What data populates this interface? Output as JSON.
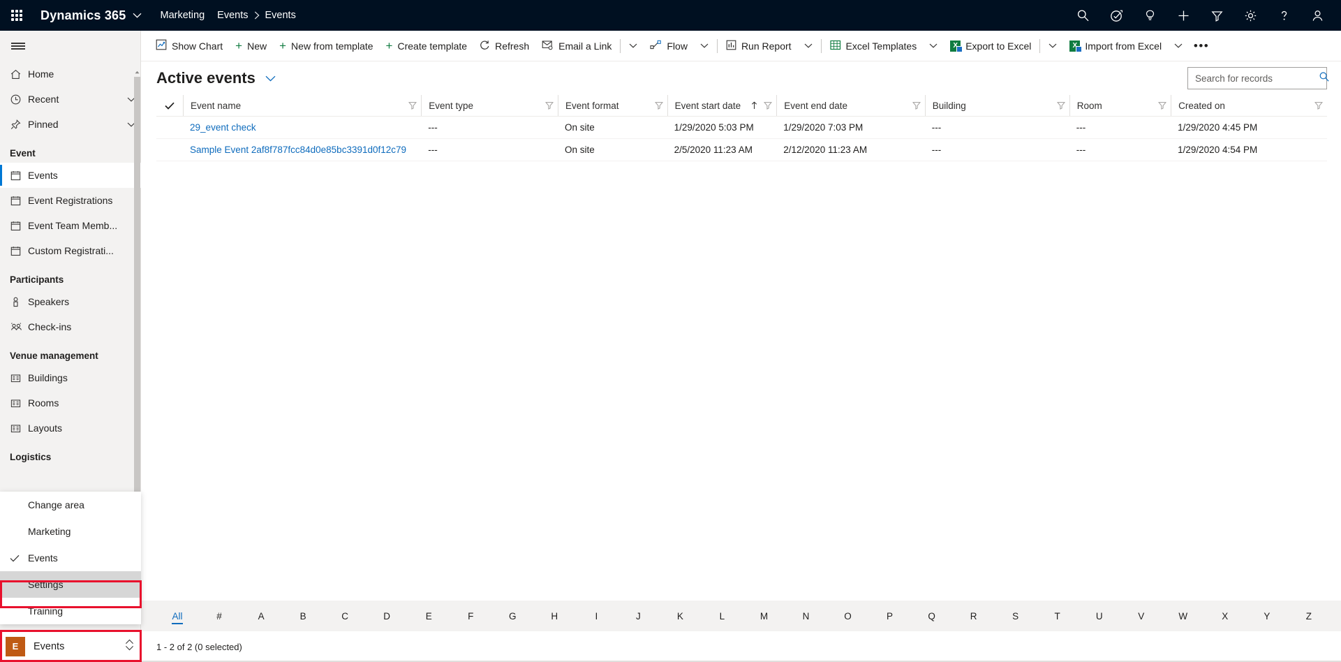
{
  "topbar": {
    "waffle_label": "app-launcher",
    "brand": "Dynamics 365",
    "app_name": "Marketing",
    "breadcrumb": [
      "Events",
      "Events"
    ],
    "icons": [
      {
        "name": "search-icon",
        "label": "Search"
      },
      {
        "name": "diagnostics-icon",
        "label": "Diagnostics"
      },
      {
        "name": "lightbulb-icon",
        "label": "Ideas"
      },
      {
        "name": "add-icon",
        "label": "Quick create"
      },
      {
        "name": "filter-icon",
        "label": "Advanced filter"
      },
      {
        "name": "gear-icon",
        "label": "Settings"
      },
      {
        "name": "help-icon",
        "label": "Help"
      },
      {
        "name": "user-avatar-icon",
        "label": "Account manager"
      }
    ]
  },
  "sidebar": {
    "hamburger_label": "Expand navigation",
    "items": [
      {
        "label": "Home",
        "icon": "home-icon",
        "chevron": false,
        "selected": false,
        "group": null
      },
      {
        "label": "Recent",
        "icon": "clock-icon",
        "chevron": true,
        "selected": false,
        "group": null
      },
      {
        "label": "Pinned",
        "icon": "pin-icon",
        "chevron": true,
        "selected": false,
        "group": null
      }
    ],
    "groups": [
      {
        "title": "Event",
        "items": [
          {
            "label": "Events",
            "icon": "calendar-icon",
            "selected": true
          },
          {
            "label": "Event Registrations",
            "icon": "calendar-icon",
            "selected": false
          },
          {
            "label": "Event Team Memb...",
            "icon": "calendar-icon",
            "selected": false
          },
          {
            "label": "Custom Registrati...",
            "icon": "calendar-icon",
            "selected": false
          }
        ]
      },
      {
        "title": "Participants",
        "items": [
          {
            "label": "Speakers",
            "icon": "speaker-person-icon",
            "selected": false
          },
          {
            "label": "Check-ins",
            "icon": "people-icon",
            "selected": false
          }
        ]
      },
      {
        "title": "Venue management",
        "items": [
          {
            "label": "Buildings",
            "icon": "building-icon",
            "selected": false
          },
          {
            "label": "Rooms",
            "icon": "building-icon",
            "selected": false
          },
          {
            "label": "Layouts",
            "icon": "building-icon",
            "selected": false
          }
        ]
      },
      {
        "title": "Logistics",
        "items": []
      }
    ],
    "area_flyout": {
      "items": [
        {
          "label": "Change area",
          "checked": false,
          "hovered": false
        },
        {
          "label": "Marketing",
          "checked": false,
          "hovered": false
        },
        {
          "label": "Events",
          "checked": true,
          "hovered": false
        },
        {
          "label": "Settings",
          "checked": false,
          "hovered": true
        },
        {
          "label": "Training",
          "checked": false,
          "hovered": false
        }
      ]
    },
    "area_switcher": {
      "badge": "E",
      "label": "Events",
      "badge_color": "#bf5a14"
    }
  },
  "commandbar": {
    "items": [
      {
        "label": "Show Chart",
        "icon": "chart-icon",
        "caret": false
      },
      {
        "label": "New",
        "icon": "plus-icon",
        "caret": false
      },
      {
        "label": "New from template",
        "icon": "plus-icon",
        "caret": false
      },
      {
        "label": "Create template",
        "icon": "plus-icon",
        "caret": false
      },
      {
        "label": "Refresh",
        "icon": "refresh-icon",
        "caret": false
      },
      {
        "label": "Email a Link",
        "icon": "email-link-icon",
        "caret": true,
        "divider_before_caret": true
      },
      {
        "label": "Flow",
        "icon": "flow-icon",
        "caret": true
      },
      {
        "label": "Run Report",
        "icon": "report-icon",
        "caret": true
      },
      {
        "label": "Excel Templates",
        "icon": "excel-icon",
        "caret": true
      },
      {
        "label": "Export to Excel",
        "icon": "excel-icon",
        "caret": true,
        "divider_before_caret": true
      },
      {
        "label": "Import from Excel",
        "icon": "excel-icon",
        "caret": true
      }
    ],
    "overflow_label": "•••"
  },
  "main": {
    "view_title": "Active events",
    "view_caret_name": "view-selector-chevron-icon",
    "search": {
      "placeholder": "Search for records",
      "value": "",
      "icon": "search-icon"
    },
    "grid": {
      "columns": [
        {
          "label": "Event name",
          "filter": true,
          "sort": null
        },
        {
          "label": "Event type",
          "filter": true,
          "sort": null
        },
        {
          "label": "Event format",
          "filter": true,
          "sort": null
        },
        {
          "label": "Event start date",
          "filter": true,
          "sort": "asc"
        },
        {
          "label": "Event end date",
          "filter": true,
          "sort": null
        },
        {
          "label": "Building",
          "filter": true,
          "sort": null
        },
        {
          "label": "Room",
          "filter": true,
          "sort": null
        },
        {
          "label": "Created on",
          "filter": true,
          "sort": null
        }
      ],
      "rows": [
        {
          "event_name": "29_event check",
          "event_type": "---",
          "event_format": "On site",
          "event_start_date": "1/29/2020 5:03 PM",
          "event_end_date": "1/29/2020 7:03 PM",
          "building": "---",
          "room": "---",
          "created_on": "1/29/2020 4:45 PM"
        },
        {
          "event_name": "Sample Event 2af8f787fcc84d0e85bc3391d0f12c79",
          "event_type": "---",
          "event_format": "On site",
          "event_start_date": "2/5/2020 11:23 AM",
          "event_end_date": "2/12/2020 11:23 AM",
          "building": "---",
          "room": "---",
          "created_on": "1/29/2020 4:54 PM"
        }
      ]
    },
    "alpha_filter": {
      "active": "All",
      "items": [
        "All",
        "#",
        "A",
        "B",
        "C",
        "D",
        "E",
        "F",
        "G",
        "H",
        "I",
        "J",
        "K",
        "L",
        "M",
        "N",
        "O",
        "P",
        "Q",
        "R",
        "S",
        "T",
        "U",
        "V",
        "W",
        "X",
        "Y",
        "Z"
      ]
    },
    "status": "1 - 2 of 2 (0 selected)"
  },
  "colors": {
    "nav_dark": "#001021",
    "accent_blue": "#0078d4",
    "link_blue": "#0f6cbd",
    "excel_green": "#107c41",
    "highlight_red": "#e8112d",
    "area_orange": "#bf5a14"
  }
}
